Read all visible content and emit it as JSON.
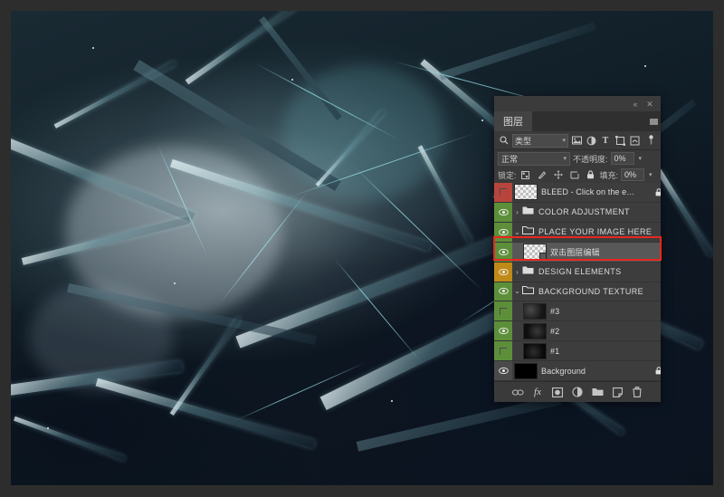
{
  "app": {
    "panel_title": "图层",
    "collapse_icon": "double-chevron-left-icon",
    "close_icon": "close-icon",
    "menu_icon": "panel-menu-icon"
  },
  "filter_bar": {
    "search_icon": "search-icon",
    "kind_label": "类型",
    "dropdown_caret": "chevron-down-icon",
    "filter_icons": [
      {
        "name": "pixel-layer-filter-icon",
        "glyph": "▣"
      },
      {
        "name": "adjustment-layer-filter-icon",
        "glyph": "◑"
      },
      {
        "name": "type-layer-filter-icon",
        "glyph": "T"
      },
      {
        "name": "shape-layer-filter-icon",
        "glyph": "⬚"
      },
      {
        "name": "smart-object-filter-icon",
        "glyph": "▧"
      }
    ],
    "toggle_icon": "filter-toggle-switch-icon"
  },
  "blend_bar": {
    "blend_mode": "正常",
    "opacity_label": "不透明度:",
    "opacity_value": "0%",
    "caret": "chevron-down-icon"
  },
  "lock_bar": {
    "lock_label": "锁定:",
    "icons": [
      {
        "name": "lock-transparent-pixels-icon",
        "glyph": "▒"
      },
      {
        "name": "lock-image-pixels-brush-icon",
        "glyph": "╱"
      },
      {
        "name": "lock-position-move-icon",
        "glyph": "✥"
      },
      {
        "name": "lock-artboard-nesting-icon",
        "glyph": "◱"
      },
      {
        "name": "lock-all-icon",
        "glyph": "🔒"
      }
    ],
    "fill_label": "填充:",
    "fill_value": "0%",
    "caret": "chevron-down-icon"
  },
  "layers": [
    {
      "name": "BLEED - Click on the e…",
      "visible": false,
      "eye_color": "#b8453c",
      "type": "layer",
      "thumb": "checker",
      "locked": true,
      "indent": 0,
      "selected": false,
      "caps": false
    },
    {
      "name": "COLOR ADJUSTMENT",
      "visible": true,
      "eye_color": "#5d8f3a",
      "type": "group",
      "expanded": false,
      "arrow": "›",
      "indent": 0,
      "selected": false,
      "caps": true
    },
    {
      "name": "PLACE YOUR IMAGE HERE",
      "visible": true,
      "eye_color": "#5d8f3a",
      "type": "group",
      "expanded": true,
      "arrow": "⌄",
      "indent": 0,
      "selected": false,
      "caps": true
    },
    {
      "name": "双击图层编辑",
      "visible": true,
      "eye_color": "#5d8f3a",
      "type": "smart-object",
      "thumb": "checker",
      "indent": 1,
      "selected": true,
      "caps": false
    },
    {
      "name": "DESIGN ELEMENTS",
      "visible": true,
      "eye_color": "#c08a18",
      "type": "group",
      "expanded": false,
      "arrow": "›",
      "indent": 0,
      "selected": false,
      "caps": true
    },
    {
      "name": "BACKGROUND TEXTURE",
      "visible": true,
      "eye_color": "#5d8f3a",
      "type": "group",
      "expanded": true,
      "arrow": "⌄",
      "indent": 0,
      "selected": false,
      "caps": true
    },
    {
      "name": "#3",
      "visible": false,
      "eye_color": "#5d8f3a",
      "type": "layer",
      "thumb": "tex1",
      "indent": 1,
      "selected": false,
      "caps": false
    },
    {
      "name": "#2",
      "visible": true,
      "eye_color": "#5d8f3a",
      "type": "layer",
      "thumb": "tex2",
      "indent": 1,
      "selected": false,
      "caps": false
    },
    {
      "name": "#1",
      "visible": false,
      "eye_color": "#5d8f3a",
      "type": "layer",
      "thumb": "tex3",
      "indent": 1,
      "selected": false,
      "caps": false
    },
    {
      "name": "Background",
      "visible": true,
      "eye_color": "#4a4a4a",
      "type": "layer",
      "thumb": "black",
      "locked": true,
      "indent": 0,
      "selected": false,
      "caps": false
    }
  ],
  "scrollbar": {
    "up_arrow": "chevron-up-icon",
    "down_arrow": "chevron-down-icon"
  },
  "footer_icons": [
    {
      "name": "link-layers-icon",
      "glyph": "⚭"
    },
    {
      "name": "layer-style-fx-icon",
      "glyph": "fx"
    },
    {
      "name": "add-layer-mask-icon",
      "glyph": "▣"
    },
    {
      "name": "new-adjustment-layer-icon",
      "glyph": "◑"
    },
    {
      "name": "new-group-icon",
      "glyph": "▬"
    },
    {
      "name": "new-layer-icon",
      "glyph": "⧉"
    },
    {
      "name": "delete-layer-icon",
      "glyph": "🗑"
    }
  ],
  "annotations": {
    "highlight_color": "#e8271f",
    "highlight_target": "双击图层编辑"
  },
  "artwork": {
    "description": "shattered glass shards on dark teal background"
  }
}
